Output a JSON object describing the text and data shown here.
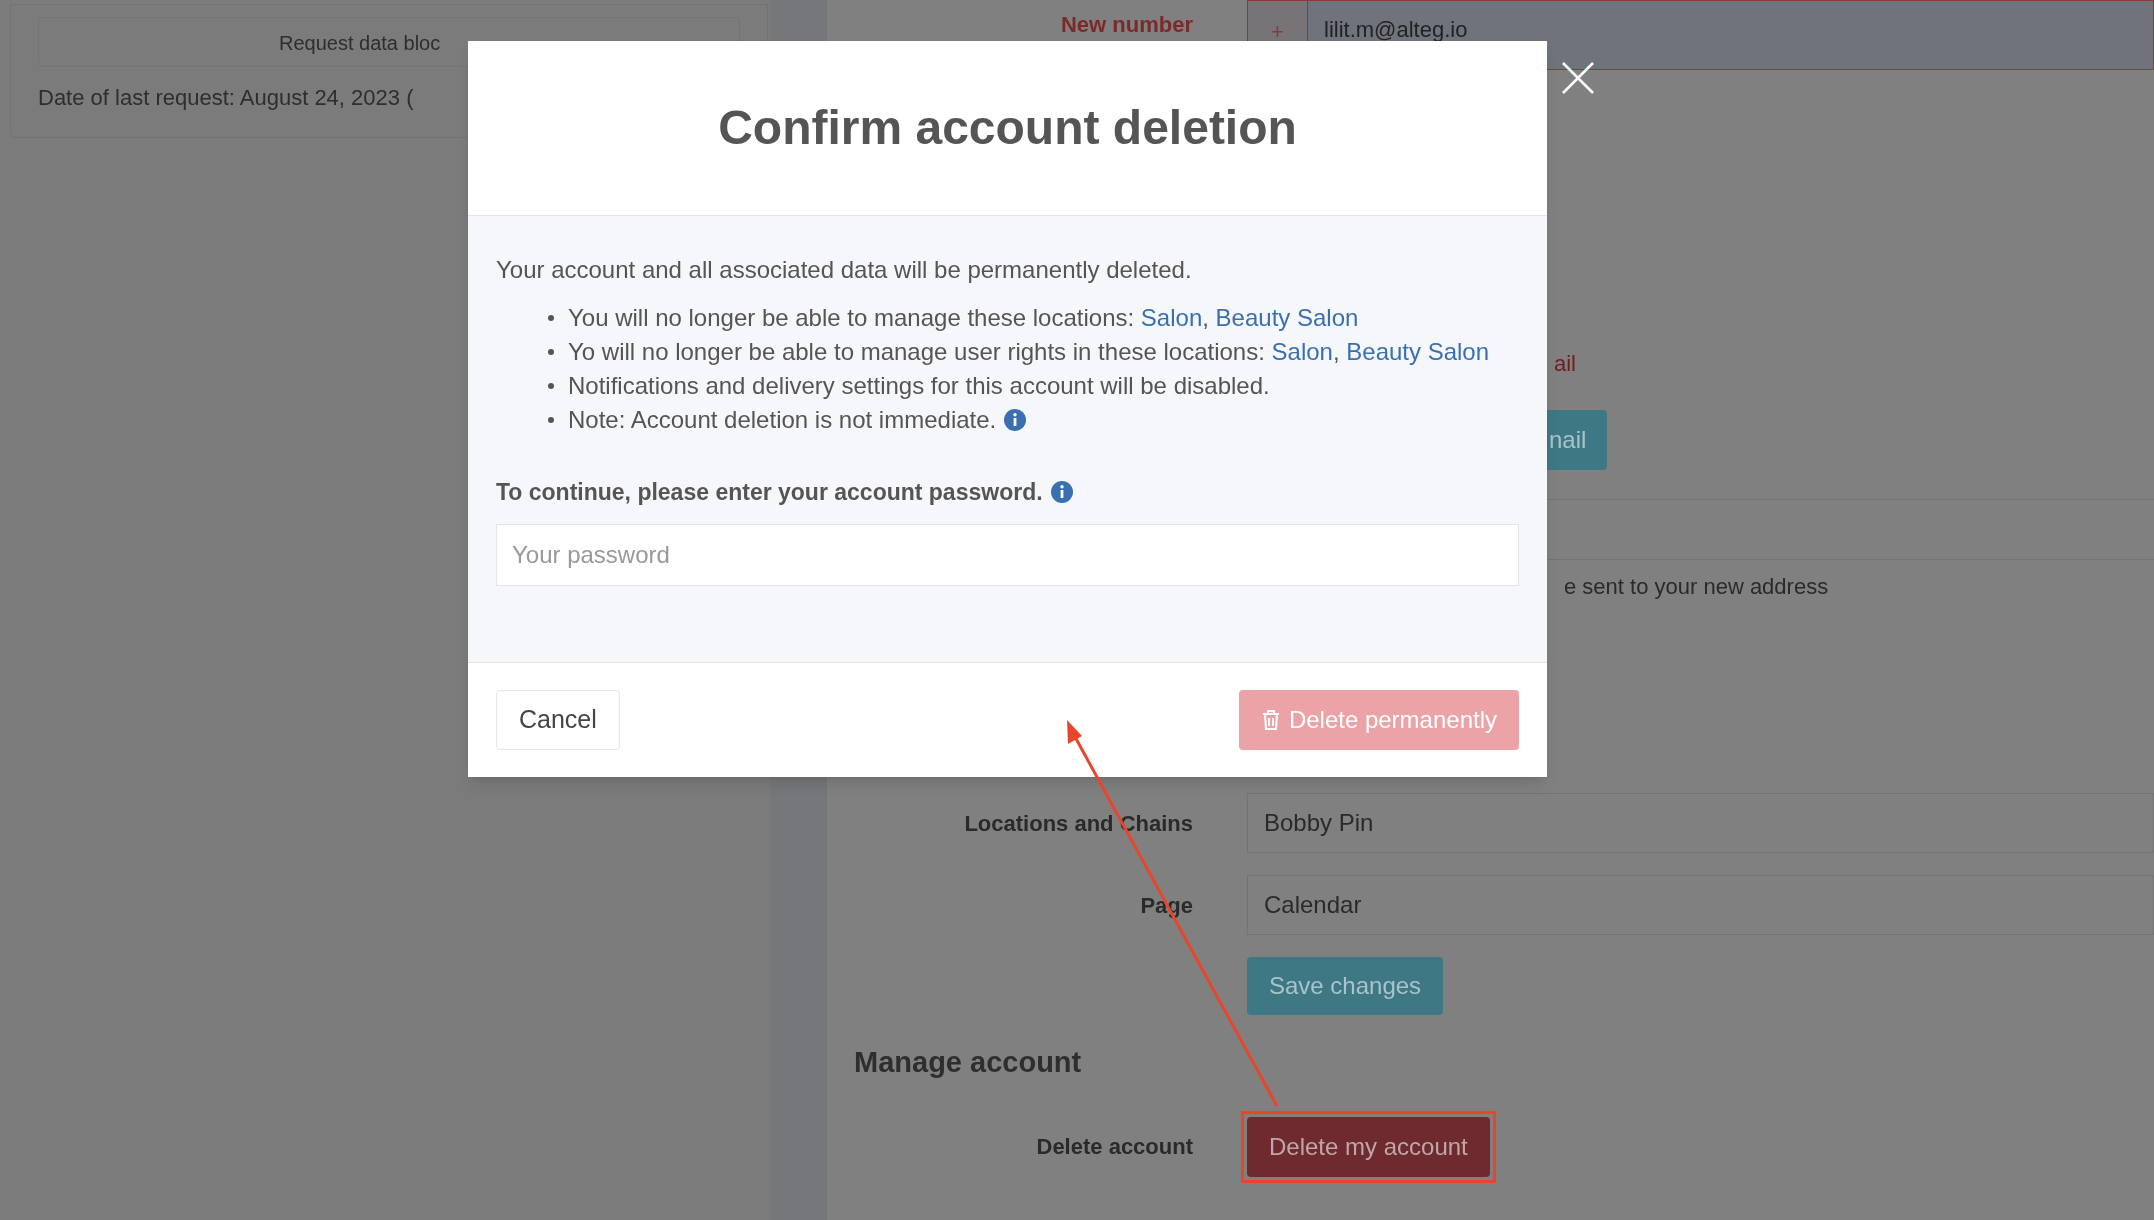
{
  "background": {
    "left_panel": {
      "button": "Request data bloc",
      "last_request": "Date of last request: August 24, 2023 ("
    },
    "form": {
      "new_number": {
        "label": "New number",
        "prefix": "+",
        "value": "lilit.m@alteg.io"
      },
      "error_fragment": "ail",
      "button_fragment": "nail",
      "note_fragment": "e sent to your new address",
      "fields": [
        {
          "label": "Locations and Chains",
          "value": "Bobby Pin"
        },
        {
          "label": "Page",
          "value": "Calendar"
        }
      ],
      "save_button": "Save changes",
      "section_title": "Manage account",
      "delete_label": "Delete account",
      "delete_button": "Delete my account"
    }
  },
  "modal": {
    "title": "Confirm account deletion",
    "intro": "Your account and all associated data will be permanently deleted.",
    "bullets": [
      {
        "parts": [
          {
            "kind": "text",
            "text": "You will no longer be able to manage these locations: "
          },
          {
            "kind": "link",
            "text": "Salon"
          },
          {
            "kind": "text",
            "text": ", "
          },
          {
            "kind": "link",
            "text": "Beauty Salon"
          }
        ],
        "info": false
      },
      {
        "parts": [
          {
            "kind": "text",
            "text": "Yo will no longer be able to manage user rights in these locations: "
          },
          {
            "kind": "link",
            "text": "Salon"
          },
          {
            "kind": "text",
            "text": ", "
          },
          {
            "kind": "link",
            "text": "Beauty Salon"
          }
        ],
        "info": false
      },
      {
        "parts": [
          {
            "kind": "text",
            "text": "Notifications and delivery settings for this account will be disabled."
          }
        ],
        "info": false
      },
      {
        "parts": [
          {
            "kind": "text",
            "text": "Note: Account deletion is not immediate."
          }
        ],
        "info": true
      }
    ],
    "password_label": "To continue, please enter your account password.",
    "password_info": true,
    "password_placeholder": "Your password",
    "cancel": "Cancel",
    "confirm": "Delete permanently",
    "confirm_disabled": true
  }
}
